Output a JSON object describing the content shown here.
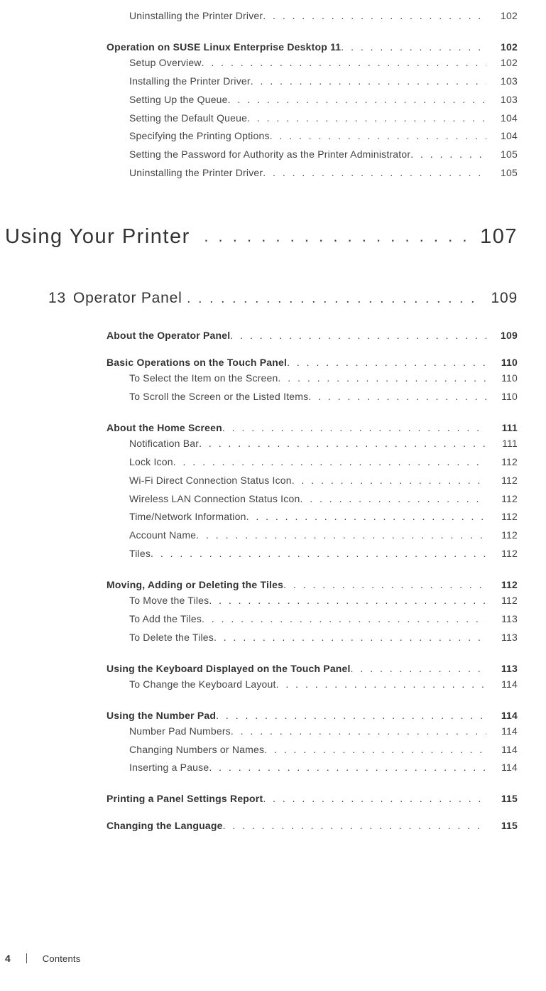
{
  "toc": {
    "initial_subsections": [
      {
        "label": "Uninstalling the Printer Driver",
        "page": "102"
      }
    ],
    "initial_section": {
      "label": "Operation on SUSE Linux Enterprise Desktop 11",
      "page": "102"
    },
    "initial_section_subs": [
      {
        "label": "Setup Overview",
        "page": "102"
      },
      {
        "label": "Installing the Printer Driver",
        "page": "103"
      },
      {
        "label": "Setting Up the Queue",
        "page": "103"
      },
      {
        "label": "Setting the Default Queue",
        "page": "104"
      },
      {
        "label": "Specifying the Printing Options",
        "page": "104"
      },
      {
        "label": "Setting the Password for Authority as the Printer Administrator",
        "page": "105"
      },
      {
        "label": "Uninstalling the Printer Driver",
        "page": "105"
      }
    ],
    "part": {
      "label": "Using Your Printer",
      "page": "107"
    },
    "chapter": {
      "number": "13",
      "label": "Operator Panel",
      "page": "109"
    },
    "sections": [
      {
        "label": "About the Operator Panel",
        "page": "109",
        "subs": []
      },
      {
        "label": "Basic Operations on the Touch Panel",
        "page": "110",
        "subs": [
          {
            "label": "To Select the Item on the Screen",
            "page": "110"
          },
          {
            "label": "To Scroll the Screen or the Listed Items",
            "page": "110"
          }
        ]
      },
      {
        "label": "About the Home Screen",
        "page": "111",
        "subs": [
          {
            "label": "Notification Bar",
            "page": "111"
          },
          {
            "label": "Lock Icon",
            "page": "112"
          },
          {
            "label": "Wi-Fi Direct Connection Status Icon",
            "page": "112"
          },
          {
            "label": "Wireless LAN Connection Status Icon",
            "page": "112"
          },
          {
            "label": "Time/Network Information",
            "page": "112"
          },
          {
            "label": "Account Name",
            "page": "112"
          },
          {
            "label": "Tiles",
            "page": "112"
          }
        ]
      },
      {
        "label": "Moving, Adding or Deleting the Tiles",
        "page": "112",
        "subs": [
          {
            "label": "To Move the Tiles",
            "page": "112"
          },
          {
            "label": "To Add the Tiles",
            "page": "113"
          },
          {
            "label": "To Delete the Tiles",
            "page": "113"
          }
        ]
      },
      {
        "label": "Using the Keyboard Displayed on the Touch Panel",
        "page": "113",
        "subs": [
          {
            "label": "To Change the Keyboard Layout",
            "page": "114"
          }
        ]
      },
      {
        "label": "Using the Number Pad",
        "page": "114",
        "subs": [
          {
            "label": "Number Pad Numbers",
            "page": "114"
          },
          {
            "label": "Changing Numbers or Names",
            "page": "114"
          },
          {
            "label": "Inserting a Pause",
            "page": "114"
          }
        ]
      },
      {
        "label": "Printing a Panel Settings Report",
        "page": "115",
        "subs": []
      },
      {
        "label": "Changing the Language",
        "page": "115",
        "subs": []
      }
    ]
  },
  "footer": {
    "page_number": "4",
    "label": "Contents"
  }
}
